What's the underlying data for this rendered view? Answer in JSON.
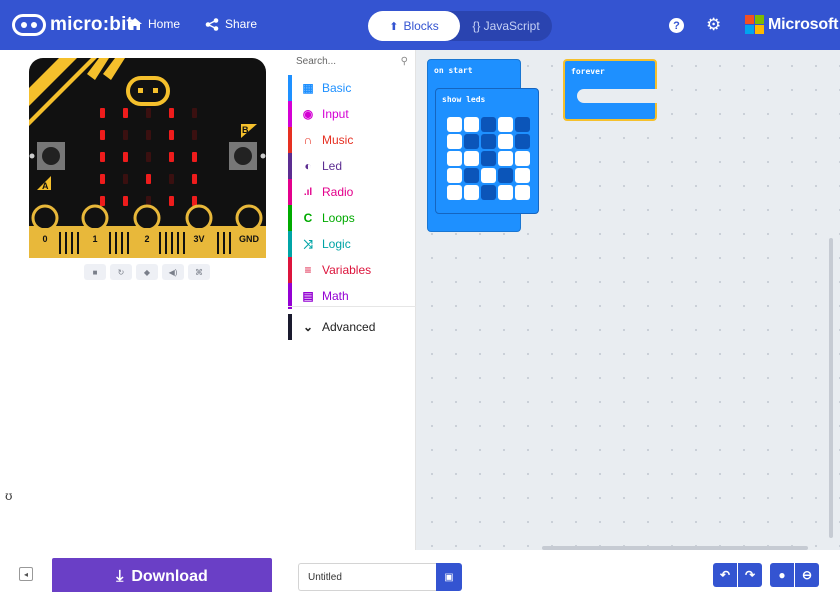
{
  "topbar": {
    "logo_text": "micro:bit",
    "home_label": "Home",
    "share_label": "Share",
    "blocks_label": "Blocks",
    "javascript_label": "{} JavaScript",
    "help_glyph": "?",
    "brand_label": "Microsoft",
    "accent_color": "#3454d1"
  },
  "simulator": {
    "pin_labels": [
      "0",
      "1",
      "2",
      "3V",
      "GND"
    ],
    "button_labels": [
      "A",
      "B"
    ],
    "controls": [
      "stop",
      "restart",
      "slow-mo",
      "mute",
      "screenshot"
    ],
    "stray_char": "ʊ"
  },
  "toolbox": {
    "search_placeholder": "Search...",
    "categories": [
      {
        "label": "Basic",
        "color": "#1e90ff",
        "icon": "grid-icon"
      },
      {
        "label": "Input",
        "color": "#d400d4",
        "icon": "target-icon"
      },
      {
        "label": "Music",
        "color": "#e63022",
        "icon": "headphones-icon"
      },
      {
        "label": "Led",
        "color": "#5c2d91",
        "icon": "toggle-icon"
      },
      {
        "label": "Radio",
        "color": "#e3008c",
        "icon": "signal-icon"
      },
      {
        "label": "Loops",
        "color": "#00aa00",
        "icon": "refresh-icon"
      },
      {
        "label": "Logic",
        "color": "#00a4a6",
        "icon": "shuffle-icon"
      },
      {
        "label": "Variables",
        "color": "#dc143c",
        "icon": "list-icon"
      },
      {
        "label": "Math",
        "color": "#9400d3",
        "icon": "calculator-icon"
      }
    ],
    "advanced_label": "Advanced"
  },
  "workspace": {
    "on_start_label": "on start",
    "show_leds_label": "show leds",
    "forever_label": "forever",
    "led_pattern": [
      [
        1,
        1,
        0,
        1,
        0
      ],
      [
        1,
        0,
        0,
        1,
        0
      ],
      [
        1,
        1,
        0,
        1,
        1
      ],
      [
        1,
        0,
        1,
        0,
        1
      ],
      [
        1,
        1,
        0,
        1,
        1
      ]
    ]
  },
  "bottombar": {
    "download_label": "Download",
    "project_title": "Untitled",
    "undo_glyph": "↶",
    "redo_glyph": "↷"
  }
}
